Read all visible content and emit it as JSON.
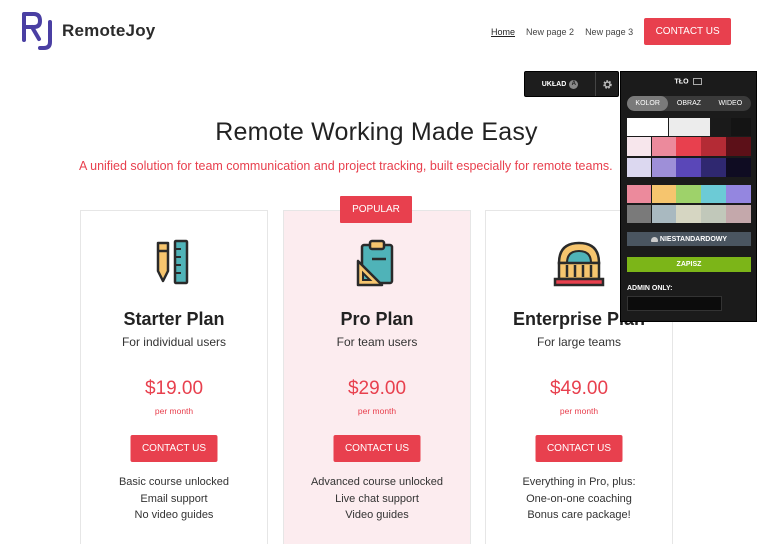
{
  "brand": {
    "initials": "RJ",
    "name": "RemoteJoy",
    "accent": "#e8404e",
    "logo_color": "#4a3fa3"
  },
  "nav": {
    "items": [
      {
        "label": "Home",
        "active": true
      },
      {
        "label": "New page 2"
      },
      {
        "label": "New page 3"
      }
    ],
    "cta_label": "CONTACT US"
  },
  "layout_toolbar": {
    "label": "UKŁAD",
    "badge": "A",
    "settings_icon": "gear-icon"
  },
  "hero": {
    "title": "Remote Working Made Easy",
    "subtitle": "A unified solution for team communication and project tracking, built especially for remote teams."
  },
  "plans": [
    {
      "name": "Starter Plan",
      "audience": "For individual users",
      "price": "$19.00",
      "period": "per month",
      "cta": "CONTACT US",
      "features": [
        "Basic course unlocked",
        "Email support",
        "No video guides"
      ],
      "icon": "pen-ruler-icon"
    },
    {
      "name": "Pro Plan",
      "audience": "For team users",
      "price": "$29.00",
      "period": "per month",
      "cta": "CONTACT US",
      "badge": "POPULAR",
      "features": [
        "Advanced course unlocked",
        "Live chat support",
        "Video guides"
      ],
      "icon": "clipboard-ruler-icon"
    },
    {
      "name": "Enterprise Plan",
      "audience": "For large teams",
      "price": "$49.00",
      "period": "per month",
      "cta": "CONTACT US",
      "features": [
        "Everything in Pro, plus:",
        "One-on-one coaching",
        "Bonus care package!"
      ],
      "icon": "building-icon"
    }
  ],
  "panel": {
    "title": "TŁO",
    "tabs": [
      {
        "label": "KOLOR",
        "active": true
      },
      {
        "label": "OBRAZ"
      },
      {
        "label": "WIDEO"
      }
    ],
    "swatches_top": [
      "#ffffff",
      "#ececec",
      "#1a1a1a",
      "#141414",
      "#f7e6ec",
      "#ec8a9c",
      "#e8404e",
      "#b42b35",
      "#5c1018",
      "#dcd8f0",
      "#9e8fd8",
      "#5a47b8",
      "#2f2870",
      "#0f0c22"
    ],
    "swatches_bottom": [
      "#ec8a9c",
      "#f6c56e",
      "#9ed26a",
      "#6ccbd6",
      "#9486e0",
      "#7a7a7a",
      "#a9b9c0",
      "#d6d6c2",
      "#c1c8ba",
      "#c4a8ab"
    ],
    "custom_label": "NIESTANDARDOWY",
    "save_label": "ZAPISZ",
    "admin_label": "ADMIN ONLY:",
    "admin_value": ""
  }
}
